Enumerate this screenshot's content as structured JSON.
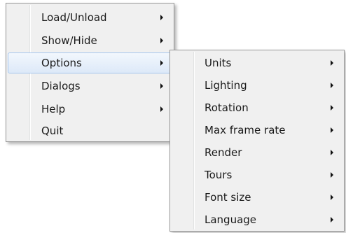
{
  "main_menu": {
    "items": [
      {
        "label": "Load/Unload",
        "has_submenu": true
      },
      {
        "label": "Show/Hide",
        "has_submenu": true
      },
      {
        "label": "Options",
        "has_submenu": true,
        "highlighted": true
      },
      {
        "label": "Dialogs",
        "has_submenu": true
      },
      {
        "label": "Help",
        "has_submenu": true
      },
      {
        "label": "Quit",
        "has_submenu": false
      }
    ]
  },
  "options_submenu": {
    "items": [
      {
        "label": "Units",
        "has_submenu": true
      },
      {
        "label": "Lighting",
        "has_submenu": true
      },
      {
        "label": "Rotation",
        "has_submenu": true
      },
      {
        "label": "Max frame rate",
        "has_submenu": true
      },
      {
        "label": "Render",
        "has_submenu": true
      },
      {
        "label": "Tours",
        "has_submenu": true
      },
      {
        "label": "Font size",
        "has_submenu": true
      },
      {
        "label": "Language",
        "has_submenu": true
      }
    ]
  },
  "colors": {
    "menu_background": "#f0f0f0",
    "menu_border": "#979797",
    "highlight_border": "#a6c7ee",
    "highlight_fill": "#dde9f8"
  }
}
